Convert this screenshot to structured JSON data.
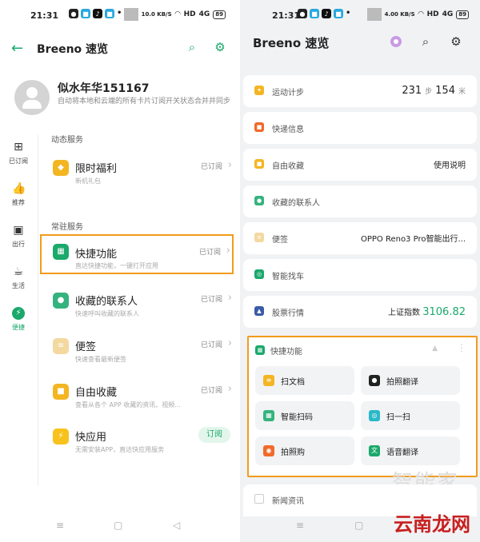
{
  "status_bar": {
    "time": "21:31",
    "speed_left": "10.0 KB/S",
    "speed_right": "4.00 KB/S",
    "network": "HD",
    "signal": "4G",
    "battery": "89"
  },
  "left": {
    "title": "Breeno 速览",
    "profile": {
      "name": "似水年华151167",
      "desc": "自动将本地和云端的所有卡片订阅开关状态合并并同步"
    },
    "sidenav": [
      {
        "label": "已订阅",
        "icon": "subscribed-icon"
      },
      {
        "label": "推荐",
        "icon": "thumbs-up-icon"
      },
      {
        "label": "出行",
        "icon": "bus-icon"
      },
      {
        "label": "生活",
        "icon": "cup-icon"
      },
      {
        "label": "便捷",
        "icon": "lightning-icon"
      }
    ],
    "section_dynamic": "动态服务",
    "section_resident": "常驻服务",
    "services": [
      {
        "name": "限时福利",
        "sub": "新机礼包",
        "status": "已订阅",
        "color": "#f4b523"
      },
      {
        "name": "快捷功能",
        "sub": "直达快捷功能，一键打开应用",
        "status": "已订阅",
        "color": "#1aa96b"
      },
      {
        "name": "收藏的联系人",
        "sub": "快速呼叫收藏的联系人",
        "status": "已订阅",
        "color": "#35b37e"
      },
      {
        "name": "便签",
        "sub": "快速查看最新便签",
        "status": "已订阅",
        "color": "#f3d9a0"
      },
      {
        "name": "自由收藏",
        "sub": "查看从各个 APP 收藏的资讯、视频...",
        "status": "已订阅",
        "color": "#f4b523"
      },
      {
        "name": "快应用",
        "sub": "无需安装APP，直达快应用服务",
        "status": "订阅",
        "color": "#f8c21c"
      }
    ]
  },
  "right": {
    "title": "Breeno 速览",
    "cards": [
      {
        "name": "运动计步",
        "icon_color": "#f4b523",
        "steps": "231",
        "steps_unit": "步",
        "distance": "154",
        "distance_unit": "米"
      },
      {
        "name": "快递信息",
        "icon_color": "#f06a2a"
      },
      {
        "name": "自由收藏",
        "icon_color": "#f4b523",
        "value": "使用说明"
      },
      {
        "name": "收藏的联系人",
        "icon_color": "#35b37e"
      },
      {
        "name": "便签",
        "icon_color": "#f3d9a0",
        "value": "OPPO Reno3 Pro智能出行..."
      },
      {
        "name": "智能找车",
        "icon_color": "#1aa96b"
      },
      {
        "name": "股票行情",
        "icon_color": "#3b5ba9",
        "value_label": "上证指数",
        "value": "3106.82"
      }
    ],
    "quick": {
      "title": "快捷功能",
      "items": [
        {
          "label": "扫文档",
          "color": "#f4b523"
        },
        {
          "label": "拍照翻译",
          "color": "#222222"
        },
        {
          "label": "智能扫码",
          "color": "#35b37e"
        },
        {
          "label": "扫一扫",
          "color": "#2ab8c9"
        },
        {
          "label": "拍照购",
          "color": "#f06a2a"
        },
        {
          "label": "语音翻译",
          "color": "#1aa96b"
        }
      ]
    },
    "news": "新闻资讯",
    "watermark": "智能家",
    "site_logo": "云南龙网"
  }
}
